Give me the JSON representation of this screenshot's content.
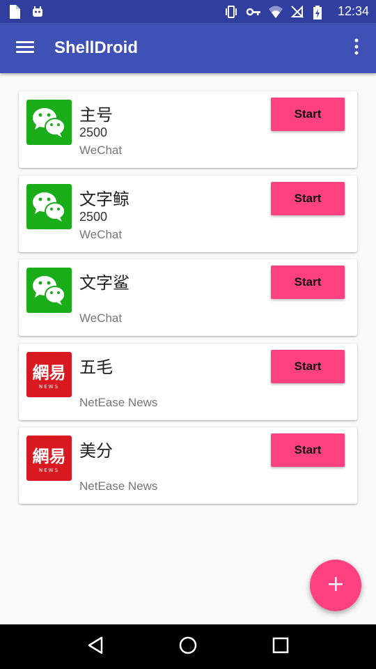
{
  "status_bar": {
    "time": "12:34",
    "left_icons": [
      "file-icon",
      "android-icon"
    ],
    "right_icons": [
      "vibrate-icon",
      "vpn-key-icon",
      "wifi-icon",
      "no-sim-icon",
      "battery-charging-icon"
    ]
  },
  "app_bar": {
    "title": "ShellDroid",
    "background": "#3F51B5"
  },
  "items": [
    {
      "name": "主号",
      "count": "2500",
      "app": "WeChat",
      "icon": "wechat-icon",
      "start_label": "Start"
    },
    {
      "name": "文字鲸",
      "count": "2500",
      "app": "WeChat",
      "icon": "wechat-icon",
      "start_label": "Start"
    },
    {
      "name": "文字鲨",
      "count": "",
      "app": "WeChat",
      "icon": "wechat-icon",
      "start_label": "Start"
    },
    {
      "name": "五毛",
      "count": "",
      "app": "NetEase News",
      "icon": "netease-news-icon",
      "start_label": "Start"
    },
    {
      "name": "美分",
      "count": "",
      "app": "NetEase News",
      "icon": "netease-news-icon",
      "start_label": "Start"
    }
  ],
  "netease_logo": {
    "text": "網易",
    "subtext": "NEWS"
  },
  "fab": {
    "icon": "plus-icon",
    "color": "#FF4081"
  },
  "nav_bar": {
    "icons": [
      "back-icon",
      "home-icon",
      "recents-icon"
    ]
  },
  "colors": {
    "accent": "#FF4081",
    "primary": "#3F51B5",
    "primary_dark": "#303F9F",
    "wechat_green": "#1AAD19",
    "netease_red": "#D91920"
  }
}
